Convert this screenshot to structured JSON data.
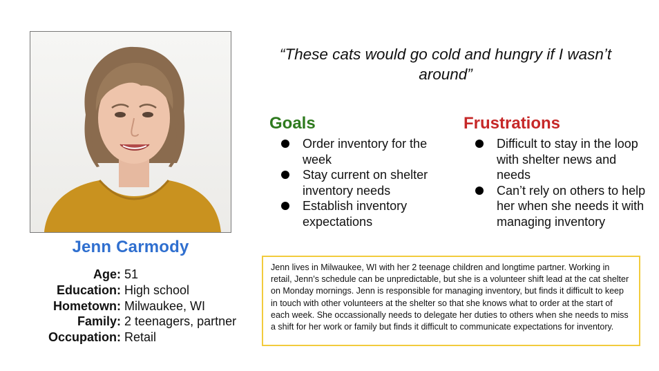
{
  "persona": {
    "name": "Jenn Carmody",
    "facts": [
      {
        "label": "Age:",
        "value": "51"
      },
      {
        "label": "Education:",
        "value": "High school"
      },
      {
        "label": "Hometown:",
        "value": "Milwaukee, WI"
      },
      {
        "label": "Family:",
        "value": "2 teenagers, partner"
      },
      {
        "label": "Occupation:",
        "value": "Retail"
      }
    ]
  },
  "quote": "“These cats would go cold and hungry if I wasn’t around”",
  "goals": {
    "title": "Goals",
    "items": [
      "Order inventory for the week",
      "Stay current on shelter inventory needs",
      "Establish inventory expectations"
    ]
  },
  "frustrations": {
    "title": "Frustrations",
    "items": [
      "Difficult to stay in the loop with shelter news and needs",
      "Can’t rely on others to help her when she needs it with managing inventory"
    ]
  },
  "bio": "Jenn lives in Milwaukee, WI with her 2 teenage children and longtime partner. Working in retail, Jenn’s schedule can be unpredictable, but she is a volunteer shift lead at the cat shelter on Monday mornings. Jenn is responsible for managing inventory, but finds it difficult to keep in touch with other volunteers at the shelter so that she knows what to order at the start of each week. She occassionally needs to delegate her duties to others when she needs to miss a shift for her work or family but finds it difficult to communicate expectations for inventory.",
  "colors": {
    "name": "#2f6fcf",
    "goals": "#2e7a1e",
    "frustrations": "#c62828",
    "bio_border": "#f2cb3d",
    "shirt": "#c9921f"
  }
}
